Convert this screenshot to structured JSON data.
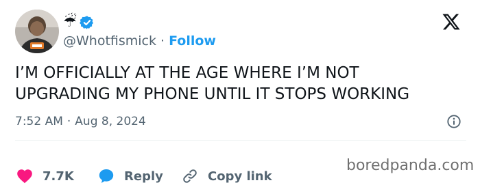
{
  "author": {
    "display_name_emoji": "☔",
    "handle": "@Whotfismick",
    "follow_label": "Follow",
    "separator": "·"
  },
  "tweet": {
    "text_lines": [
      "I’M OFFICIALLY AT THE AGE WHERE I’M NOT",
      "UPGRADING MY PHONE UNTIL IT STOPS WORKING"
    ],
    "time": "7:52 AM",
    "date": "Aug 8, 2024",
    "separator": "·"
  },
  "actions": {
    "like_count": "7.7K",
    "reply_label": "Reply",
    "copy_link_label": "Copy link"
  },
  "watermark": "boredpanda.com",
  "colors": {
    "accent": "#1d9bf0",
    "like": "#f91880",
    "text": "#0f1419",
    "muted": "#536471"
  },
  "icons": {
    "verified": "verified-badge-icon",
    "platform": "x-logo-icon",
    "info": "info-icon",
    "like": "heart-icon",
    "reply": "speech-bubble-icon",
    "copy_link": "link-icon"
  }
}
